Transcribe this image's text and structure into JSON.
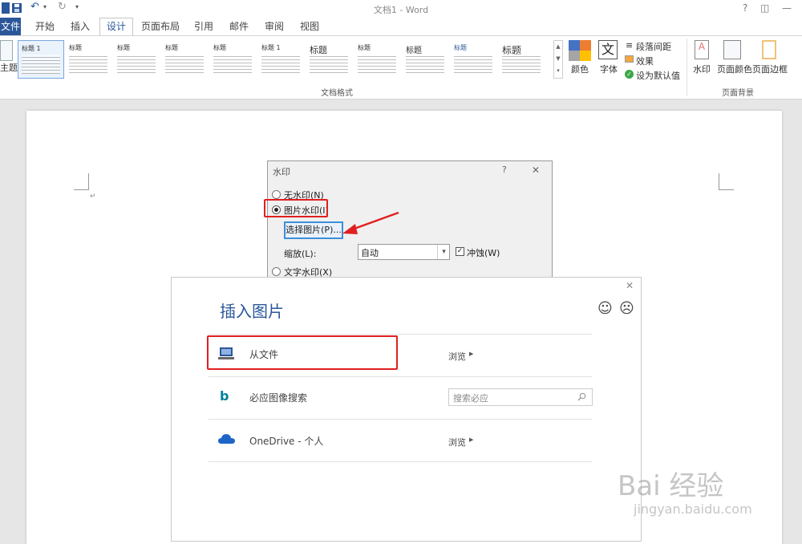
{
  "window": {
    "title": "文档1 - Word",
    "help_label": "?",
    "restore_label": "◫",
    "minimize_label": "—"
  },
  "quick_access": {
    "undo_label": "↶",
    "redo_label": "↻"
  },
  "tabs": {
    "file": "文件",
    "items": [
      "开始",
      "插入",
      "设计",
      "页面布局",
      "引用",
      "邮件",
      "审阅",
      "视图"
    ]
  },
  "ribbon": {
    "theme_label": "主题",
    "gallery": [
      "标题 1",
      "标题",
      "标题",
      "标题",
      "标题",
      "标题 1",
      "标题",
      "标题",
      "标题",
      "标题",
      "标题"
    ],
    "group_doc_format": "文档格式",
    "colors_label": "颜色",
    "fonts_label": "字体",
    "paragraph_spacing_label": "段落间距",
    "effects_label": "效果",
    "set_default_label": "设为默认值",
    "watermark_label": "水印",
    "page_color_label": "页面颜色",
    "page_border_label": "页面边框",
    "group_page_bg": "页面背景"
  },
  "watermark_dialog": {
    "title": "水印",
    "help": "?",
    "close": "✕",
    "no_watermark": "无水印(N)",
    "picture_watermark": "图片水印(I)",
    "select_picture": "选择图片(P)...",
    "scale_label": "缩放(L):",
    "scale_value": "自动",
    "washout_label": "冲蚀(W)",
    "text_watermark": "文字水印(X)",
    "selected": "picture"
  },
  "insert_picture": {
    "title": "插入图片",
    "close": "✕",
    "smile": "☺",
    "frown": "☹",
    "rows": {
      "from_file": {
        "label": "从文件",
        "action": "浏览"
      },
      "bing": {
        "label": "必应图像搜索",
        "placeholder": "搜索必应"
      },
      "onedrive": {
        "label": "OneDrive - 个人",
        "action": "浏览"
      }
    }
  },
  "watermark_text": {
    "brand": "Bai 经验",
    "url": "jingyan.baidu.com"
  }
}
